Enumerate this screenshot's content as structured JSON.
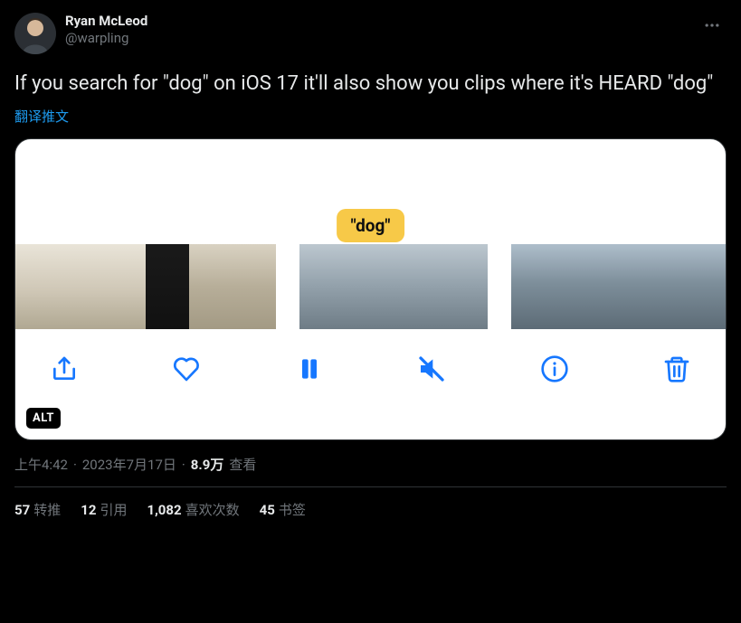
{
  "user": {
    "display_name": "Ryan McLeod",
    "handle": "@warpling"
  },
  "body_text": "If you search for \"dog\" on iOS 17 it'll also show you clips where it's HEARD \"dog\"",
  "translate_label": "翻译推文",
  "media": {
    "pill_text": "\"dog\"",
    "alt_badge": "ALT",
    "toolbar": {
      "share": "share-icon",
      "like": "heart-icon",
      "pause": "pause-icon",
      "mute": "muted-icon",
      "info": "info-icon",
      "delete": "trash-icon"
    }
  },
  "meta": {
    "time": "上午4:42",
    "sep": "·",
    "date": "2023年7月17日",
    "views_count": "8.9万",
    "views_label": "查看"
  },
  "stats": {
    "retweets": {
      "count": "57",
      "label": "转推"
    },
    "quotes": {
      "count": "12",
      "label": "引用"
    },
    "likes": {
      "count": "1,082",
      "label": "喜欢次数"
    },
    "bookmarks": {
      "count": "45",
      "label": "书签"
    }
  }
}
